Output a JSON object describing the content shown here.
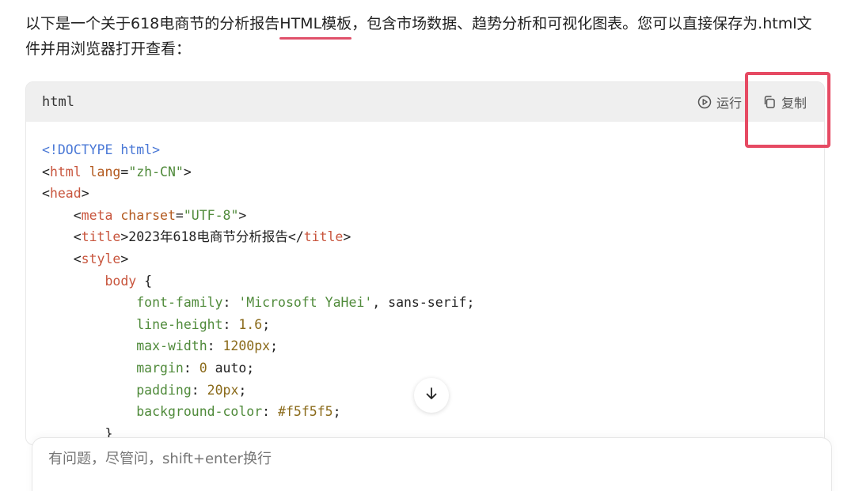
{
  "intro": {
    "before": "以下是一个关于618电商节的分析报告",
    "link": "HTML模板",
    "after": "，包含市场数据、趋势分析和可视化图表。您可以直接保存为.html文件并用浏览器打开查看："
  },
  "code_block": {
    "language": "html",
    "run_label": "运行",
    "copy_label": "复制",
    "lines": [
      [
        {
          "t": "doc",
          "v": "<!DOCTYPE html>"
        }
      ],
      [
        {
          "t": "txt",
          "v": "<"
        },
        {
          "t": "tag",
          "v": "html"
        },
        {
          "t": "txt",
          "v": " "
        },
        {
          "t": "attr",
          "v": "lang"
        },
        {
          "t": "txt",
          "v": "="
        },
        {
          "t": "str",
          "v": "\"zh-CN\""
        },
        {
          "t": "txt",
          "v": ">"
        }
      ],
      [
        {
          "t": "txt",
          "v": "<"
        },
        {
          "t": "tag",
          "v": "head"
        },
        {
          "t": "txt",
          "v": ">"
        }
      ],
      [
        {
          "t": "txt",
          "v": "    <"
        },
        {
          "t": "tag",
          "v": "meta"
        },
        {
          "t": "txt",
          "v": " "
        },
        {
          "t": "attr",
          "v": "charset"
        },
        {
          "t": "txt",
          "v": "="
        },
        {
          "t": "str",
          "v": "\"UTF-8\""
        },
        {
          "t": "txt",
          "v": ">"
        }
      ],
      [
        {
          "t": "txt",
          "v": "    <"
        },
        {
          "t": "tag",
          "v": "title"
        },
        {
          "t": "txt",
          "v": ">2023年618电商节分析报告</"
        },
        {
          "t": "tag",
          "v": "title"
        },
        {
          "t": "txt",
          "v": ">"
        }
      ],
      [
        {
          "t": "txt",
          "v": "    <"
        },
        {
          "t": "tag",
          "v": "style"
        },
        {
          "t": "txt",
          "v": ">"
        }
      ],
      [
        {
          "t": "txt",
          "v": "        "
        },
        {
          "t": "sel",
          "v": "body"
        },
        {
          "t": "txt",
          "v": " {"
        }
      ],
      [
        {
          "t": "txt",
          "v": "            "
        },
        {
          "t": "prop",
          "v": "font-family"
        },
        {
          "t": "txt",
          "v": ": "
        },
        {
          "t": "str",
          "v": "'Microsoft YaHei'"
        },
        {
          "t": "txt",
          "v": ", sans-serif;"
        }
      ],
      [
        {
          "t": "txt",
          "v": "            "
        },
        {
          "t": "prop",
          "v": "line-height"
        },
        {
          "t": "txt",
          "v": ": "
        },
        {
          "t": "num",
          "v": "1.6"
        },
        {
          "t": "txt",
          "v": ";"
        }
      ],
      [
        {
          "t": "txt",
          "v": "            "
        },
        {
          "t": "prop",
          "v": "max-width"
        },
        {
          "t": "txt",
          "v": ": "
        },
        {
          "t": "num",
          "v": "1200px"
        },
        {
          "t": "txt",
          "v": ";"
        }
      ],
      [
        {
          "t": "txt",
          "v": "            "
        },
        {
          "t": "prop",
          "v": "margin"
        },
        {
          "t": "txt",
          "v": ": "
        },
        {
          "t": "num",
          "v": "0"
        },
        {
          "t": "txt",
          "v": " auto;"
        }
      ],
      [
        {
          "t": "txt",
          "v": "            "
        },
        {
          "t": "prop",
          "v": "padding"
        },
        {
          "t": "txt",
          "v": ": "
        },
        {
          "t": "num",
          "v": "20px"
        },
        {
          "t": "txt",
          "v": ";"
        }
      ],
      [
        {
          "t": "txt",
          "v": "            "
        },
        {
          "t": "prop",
          "v": "background-color"
        },
        {
          "t": "txt",
          "v": ": "
        },
        {
          "t": "num",
          "v": "#f5f5f5"
        },
        {
          "t": "txt",
          "v": ";"
        }
      ],
      [
        {
          "t": "txt",
          "v": "        }"
        }
      ]
    ]
  },
  "composer": {
    "placeholder": "有问题，尽管问，shift+enter换行"
  },
  "icons": {
    "run": "play-circle-icon",
    "copy": "copy-icon",
    "scroll": "arrow-down-icon"
  },
  "colors": {
    "highlight": "#e64a63",
    "underline": "#e0506a"
  }
}
